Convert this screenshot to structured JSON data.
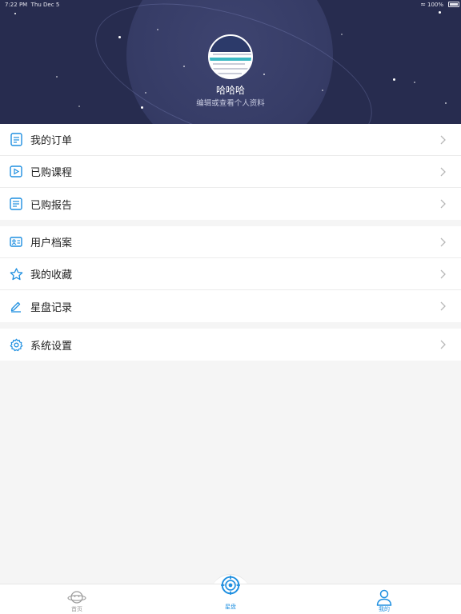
{
  "status_bar": {
    "time": "7:22 PM",
    "date": "Thu Dec 5",
    "battery": "100%",
    "wifi_icon": "wifi-icon",
    "battery_icon": "battery-icon"
  },
  "profile": {
    "username": "哈哈哈",
    "hint": "编辑或查看个人资料",
    "avatar_icon": "avatar-image"
  },
  "menu_groups": [
    {
      "items": [
        {
          "label": "我的订单",
          "icon": "order-icon"
        },
        {
          "label": "已购课程",
          "icon": "video-icon"
        },
        {
          "label": "已购报告",
          "icon": "report-icon"
        }
      ]
    },
    {
      "items": [
        {
          "label": "用户档案",
          "icon": "profile-card-icon"
        },
        {
          "label": "我的收藏",
          "icon": "star-icon"
        },
        {
          "label": "星盘记录",
          "icon": "pencil-icon"
        }
      ]
    },
    {
      "items": [
        {
          "label": "系统设置",
          "icon": "gear-icon"
        }
      ]
    }
  ],
  "tabbar": {
    "tabs": [
      {
        "label": "首页",
        "icon": "home-planet-icon",
        "active": false
      },
      {
        "label": "星盘",
        "icon": "astrolabe-icon",
        "active": false
      },
      {
        "label": "我的",
        "icon": "user-icon",
        "active": true
      }
    ]
  },
  "colors": {
    "hero_bg": "#272c4f",
    "accent": "#1e8fe0",
    "tab_inactive": "#999999"
  }
}
